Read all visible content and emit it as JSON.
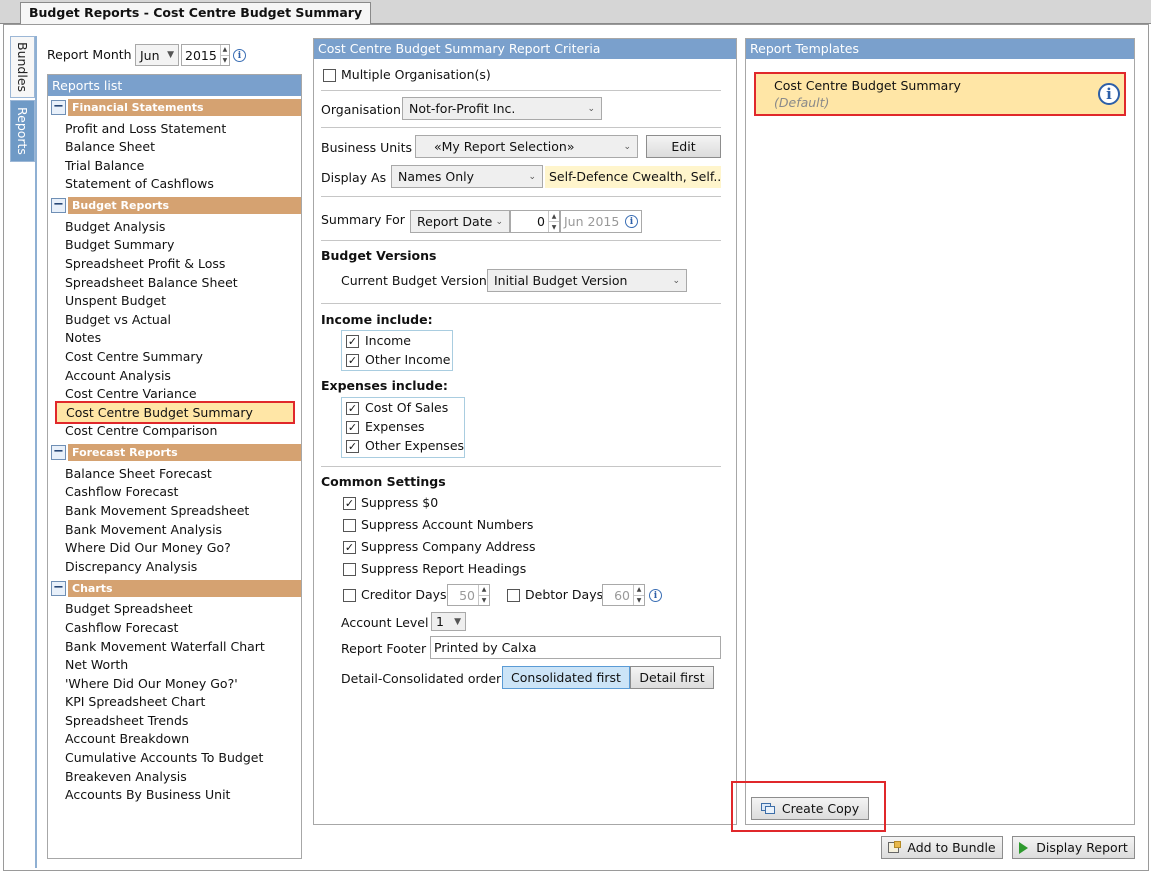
{
  "window": {
    "tab_title": "Budget Reports - Cost Centre Budget Summary"
  },
  "side_tabs": {
    "bundles": "Bundles",
    "reports": "Reports"
  },
  "report_month": {
    "label": "Report Month",
    "month": "Jun",
    "year": "2015"
  },
  "reports_list": {
    "title": "Reports list",
    "groups": [
      {
        "name": "Financial Statements",
        "items": [
          "Profit and Loss Statement",
          "Balance Sheet",
          "Trial Balance",
          "Statement of Cashflows"
        ]
      },
      {
        "name": "Budget Reports",
        "items": [
          "Budget Analysis",
          "Budget Summary",
          "Spreadsheet Profit & Loss",
          "Spreadsheet Balance Sheet",
          "Unspent Budget",
          "Budget vs Actual",
          "Notes",
          "Cost Centre Summary",
          "Account Analysis",
          "Cost Centre Variance",
          "Cost Centre Budget Summary",
          "Cost Centre Comparison"
        ]
      },
      {
        "name": "Forecast Reports",
        "items": [
          "Balance Sheet Forecast",
          "Cashflow Forecast",
          "Bank Movement Spreadsheet",
          "Bank Movement Analysis",
          "Where Did Our Money Go?",
          "Discrepancy Analysis"
        ]
      },
      {
        "name": "Charts",
        "items": [
          "Budget Spreadsheet",
          "Cashflow Forecast",
          "Bank Movement Waterfall Chart",
          "Net Worth",
          "'Where Did Our Money Go?'",
          "KPI Spreadsheet Chart",
          "Spreadsheet Trends",
          "Account Breakdown",
          "Cumulative Accounts To Budget",
          "Breakeven Analysis",
          "Accounts By Business Unit"
        ]
      }
    ]
  },
  "criteria": {
    "title": "Cost Centre Budget Summary  Report Criteria",
    "multiple_orgs": "Multiple Organisation(s)",
    "organisation_label": "Organisation",
    "organisation_value": "Not-for-Profit Inc.",
    "business_units_label": "Business Units",
    "business_units_value": "«My Report Selection»",
    "edit_label": "Edit",
    "display_as_label": "Display As",
    "display_as_value": "Names Only",
    "display_as_note": "Self-Defence Cwealth, Self...",
    "summary_for_label": "Summary For",
    "summary_for_value": "Report Date",
    "summary_offset": "0",
    "summary_date": "Jun 2015",
    "budget_versions_heading": "Budget Versions",
    "current_budget_label": "Current Budget Version",
    "current_budget_value": "Initial Budget Version",
    "income_heading": "Income include:",
    "income_items": [
      "Income",
      "Other Income"
    ],
    "expenses_heading": "Expenses include:",
    "expense_items": [
      "Cost Of Sales",
      "Expenses",
      "Other Expenses"
    ],
    "common_heading": "Common Settings",
    "suppress_zero": "Suppress $0",
    "suppress_account_numbers": "Suppress Account Numbers",
    "suppress_company_address": "Suppress Company Address",
    "suppress_report_headings": "Suppress Report Headings",
    "creditor_days_label": "Creditor Days",
    "creditor_days_value": "50",
    "debtor_days_label": "Debtor Days",
    "debtor_days_value": "60",
    "account_level_label": "Account Level",
    "account_level_value": "1",
    "report_footer_label": "Report Footer",
    "report_footer_value": "Printed by Calxa",
    "detail_order_label": "Detail-Consolidated order",
    "consolidated_first": "Consolidated first",
    "detail_first": "Detail first"
  },
  "templates": {
    "title": "Report Templates",
    "item_name": "Cost Centre Budget Summary",
    "item_tag": "(Default)",
    "create_copy": "Create Copy"
  },
  "footer": {
    "add_to_bundle": "Add to Bundle",
    "display_report": "Display Report"
  },
  "colors": {
    "panel_header": "#7aa0cc",
    "group_header": "#d5a271",
    "selected": "#ffe6a6",
    "highlight_border": "#e0282b"
  }
}
